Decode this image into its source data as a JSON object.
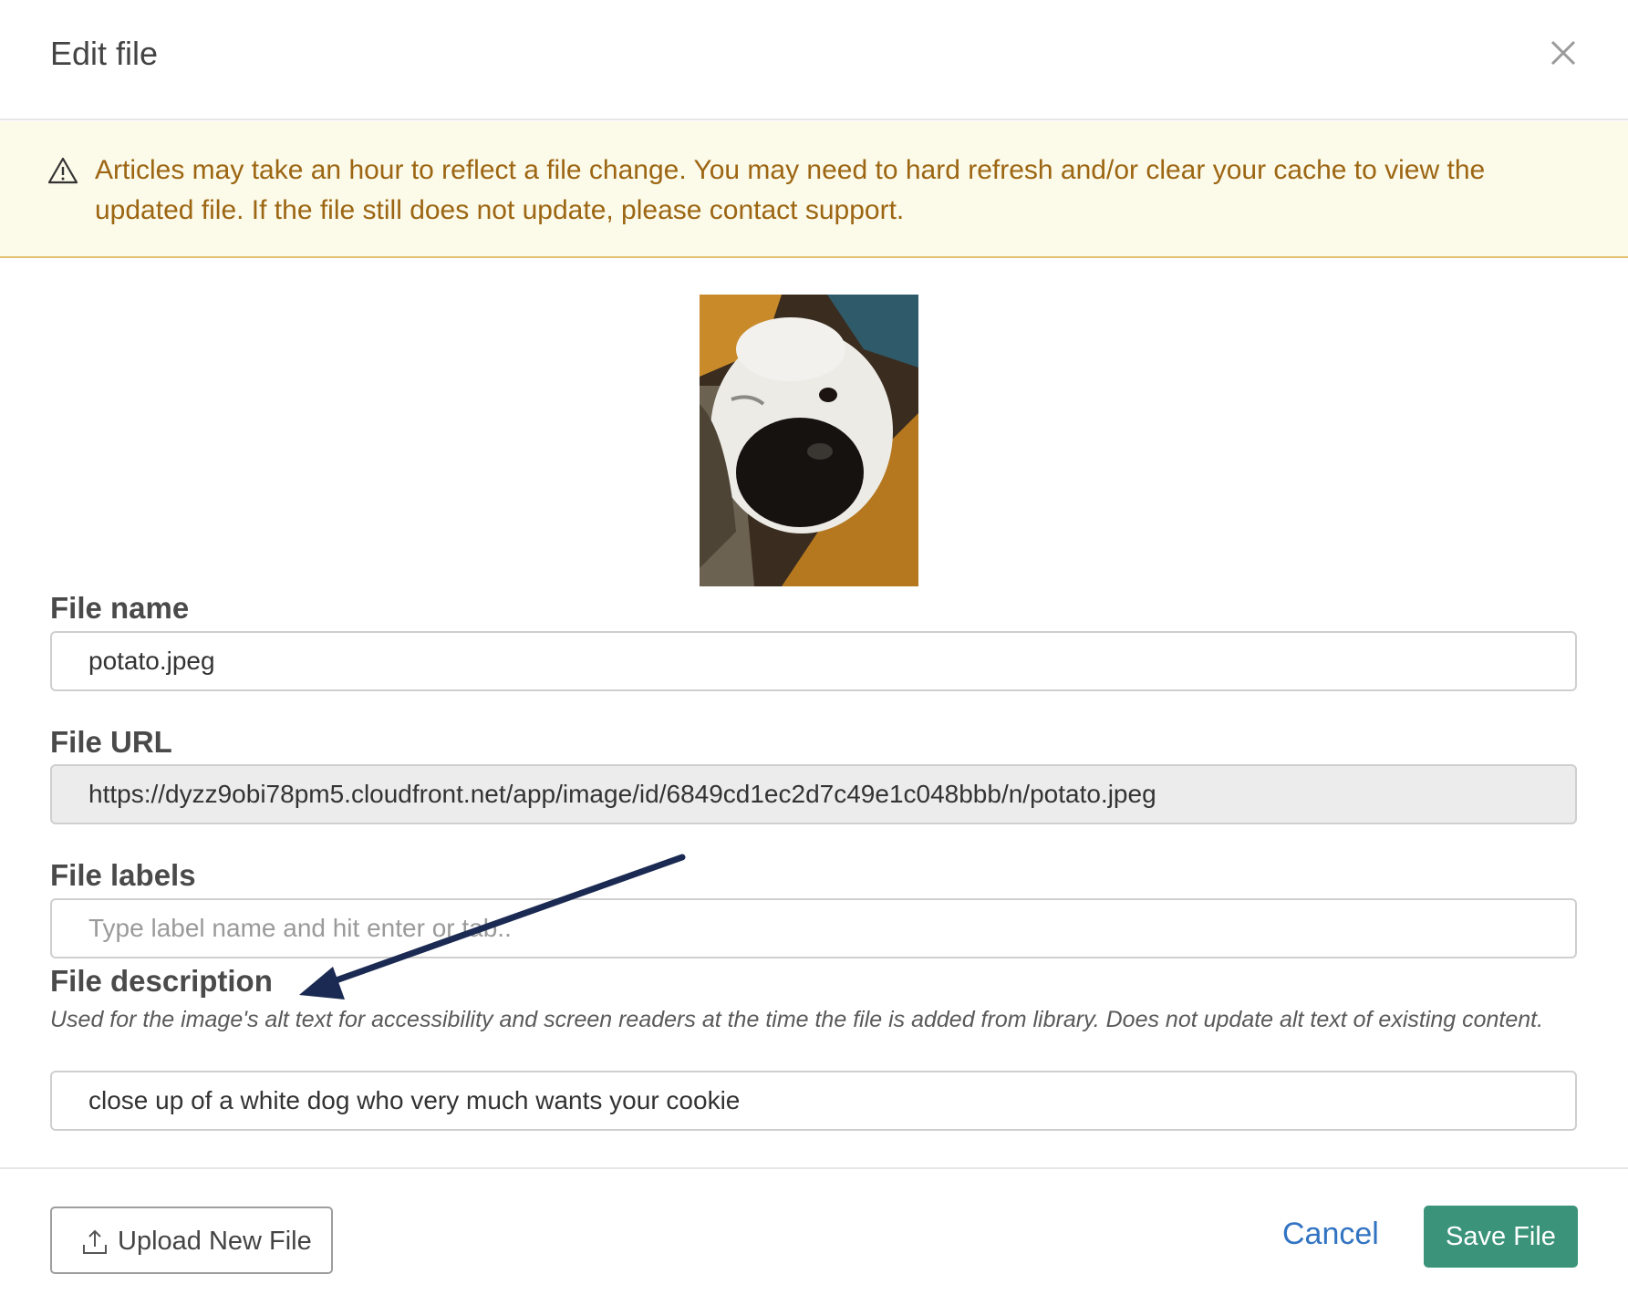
{
  "modal": {
    "title": "Edit file",
    "close_icon": "close-icon"
  },
  "alert": {
    "icon": "warning-triangle-icon",
    "text": "Articles may take an hour to reflect a file change. You may need to hard refresh and/or clear your cache to view the updated file. If the file still does not update, please contact support."
  },
  "preview": {
    "alt": "close up of a white dog who very much wants your cookie"
  },
  "fields": {
    "file_name": {
      "label": "File name",
      "value": "potato.jpeg"
    },
    "file_url": {
      "label": "File URL",
      "value": "https://dyzz9obi78pm5.cloudfront.net/app/image/id/6849cd1ec2d7c49e1c048bbb/n/potato.jpeg"
    },
    "file_labels": {
      "label": "File labels",
      "placeholder": "Type label name and hit enter or tab.."
    },
    "file_description": {
      "label": "File description",
      "help": "Used for the image's alt text for accessibility and screen readers at the time the file is added from library. Does not update alt text of existing content.",
      "value": "close up of a white dog who very much wants your cookie"
    }
  },
  "footer": {
    "upload_label": "Upload New File",
    "upload_icon": "upload-icon",
    "cancel_label": "Cancel",
    "save_label": "Save File"
  },
  "colors": {
    "alert_bg": "#fcfae9",
    "alert_text": "#9c6613",
    "save_bg": "#3b9479",
    "cancel_link": "#3274c2",
    "annotation_arrow": "#1b2a52"
  }
}
